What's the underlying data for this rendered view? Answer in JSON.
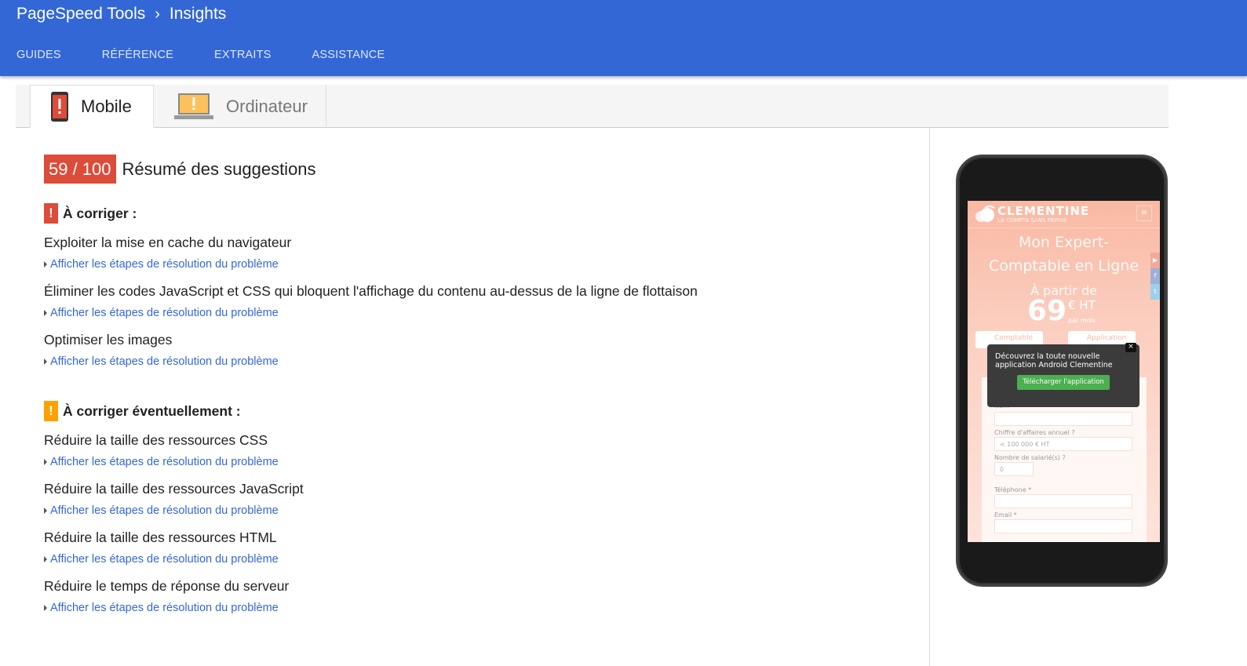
{
  "header": {
    "brand": "PageSpeed Tools",
    "separator": "›",
    "page": "Insights",
    "nav": [
      "GUIDES",
      "RÉFÉRENCE",
      "EXTRAITS",
      "ASSISTANCE"
    ]
  },
  "tabs": [
    {
      "label": "Mobile",
      "icon": "mobile-warning-icon",
      "active": true
    },
    {
      "label": "Ordinateur",
      "icon": "desktop-warning-icon",
      "active": false
    }
  ],
  "score": {
    "value": "59 / 100",
    "color": "#dd4b39",
    "summary": "Résumé des suggestions"
  },
  "link_label": "Afficher les étapes de résolution du problème",
  "sections": [
    {
      "title": "À corriger :",
      "color": "#dd4b39",
      "rules": [
        "Exploiter la mise en cache du navigateur",
        "Éliminer les codes JavaScript et CSS qui bloquent l'affichage du contenu au-dessus de la ligne de flottaison",
        "Optimiser les images"
      ]
    },
    {
      "title": "À corriger éventuellement :",
      "color": "#ffa000",
      "rules": [
        "Réduire la taille des ressources CSS",
        "Réduire la taille des ressources JavaScript",
        "Réduire la taille des ressources HTML",
        "Réduire le temps de réponse du serveur"
      ]
    }
  ],
  "preview": {
    "logo": "CLEMENTINE",
    "tagline": "LA COMPTA SANS PEPINS",
    "hero1": "Mon Expert-",
    "hero2": "Comptable en Ligne",
    "from": "À partir de",
    "price": "69",
    "unit": "€ HT",
    "per": "par mois",
    "chip1": "Comptable",
    "chip2": "Application",
    "popup_text": "Découvrez la toute nouvelle application Android Clementine",
    "popup_button": "Télécharger l'application",
    "close": "×",
    "fields": {
      "name": "Nom",
      "revenue": "Chiffre d'affaires annuel ?",
      "revenue_value": "< 100 000 € HT",
      "employees": "Nombre de salarié(s) ?",
      "employees_value": "0",
      "phone": "Téléphone *",
      "email": "Email *"
    }
  }
}
